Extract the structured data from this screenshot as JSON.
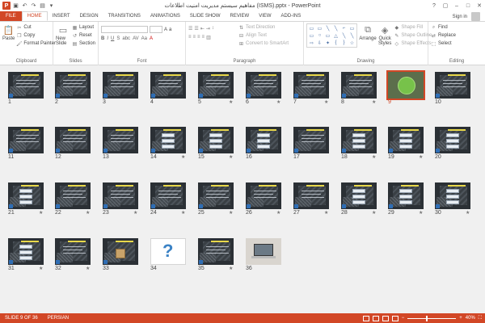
{
  "window": {
    "title": "مفاهیم سیستم مدیریت امنیت اطلاعات (ISMS).pptx - PowerPoint",
    "app_logo": "P",
    "controls": [
      "?",
      "▢",
      "–",
      "□",
      "✕"
    ]
  },
  "tabs": [
    "FILE",
    "HOME",
    "INSERT",
    "DESIGN",
    "TRANSITIONS",
    "ANIMATIONS",
    "SLIDE SHOW",
    "REVIEW",
    "VIEW",
    "ADD-INS"
  ],
  "active_tab": "HOME",
  "account": {
    "signin": "Sign in"
  },
  "ribbon": {
    "clipboard": {
      "label": "Clipboard",
      "paste": "Paste",
      "cut": "Cut",
      "copy": "Copy",
      "format_painter": "Format Painter"
    },
    "slides": {
      "label": "Slides",
      "new_slide": "New Slide",
      "layout": "Layout",
      "reset": "Reset",
      "section": "Section"
    },
    "font": {
      "label": "Font",
      "format_buttons": [
        "B",
        "I",
        "U",
        "S",
        "abc",
        "AV",
        "Aa",
        "A"
      ]
    },
    "paragraph": {
      "label": "Paragraph",
      "text_direction": "Text Direction",
      "align_text": "Align Text",
      "convert_smartart": "Convert to SmartArt"
    },
    "drawing": {
      "label": "Drawing",
      "arrange": "Arrange",
      "quick_styles": "Quick Styles",
      "shape_fill": "Shape Fill",
      "shape_outline": "Shape Outline",
      "shape_effects": "Shape Effects",
      "shapes": [
        "▭",
        "▭",
        "╲",
        "╲",
        "⌐",
        "▭",
        "▭",
        "○",
        "▭",
        "△",
        "╲",
        "╲",
        "⇨",
        "⇩",
        "✦",
        "{",
        "}",
        "☆"
      ]
    },
    "editing": {
      "label": "Editing",
      "find": "Find",
      "replace": "Replace",
      "select": "Select"
    }
  },
  "slides": [
    {
      "n": "1",
      "star": false,
      "style": "dark"
    },
    {
      "n": "2",
      "star": false,
      "style": "dark"
    },
    {
      "n": "3",
      "star": false,
      "style": "dark"
    },
    {
      "n": "4",
      "star": false,
      "style": "dark"
    },
    {
      "n": "5",
      "star": true,
      "style": "dark"
    },
    {
      "n": "6",
      "star": true,
      "style": "dark"
    },
    {
      "n": "7",
      "star": true,
      "style": "dark"
    },
    {
      "n": "8",
      "star": true,
      "style": "dark"
    },
    {
      "n": "9",
      "star": false,
      "style": "green",
      "selected": true
    },
    {
      "n": "10",
      "star": false,
      "style": "dark"
    },
    {
      "n": "11",
      "star": false,
      "style": "dark"
    },
    {
      "n": "12",
      "star": false,
      "style": "dark"
    },
    {
      "n": "13",
      "star": false,
      "style": "dark"
    },
    {
      "n": "14",
      "star": true,
      "style": "boxes"
    },
    {
      "n": "15",
      "star": true,
      "style": "boxes"
    },
    {
      "n": "16",
      "star": false,
      "style": "boxes"
    },
    {
      "n": "17",
      "star": false,
      "style": "dark"
    },
    {
      "n": "18",
      "star": true,
      "style": "boxes"
    },
    {
      "n": "19",
      "star": true,
      "style": "boxes"
    },
    {
      "n": "20",
      "star": false,
      "style": "boxes"
    },
    {
      "n": "21",
      "star": true,
      "style": "boxes"
    },
    {
      "n": "22",
      "star": true,
      "style": "dark"
    },
    {
      "n": "23",
      "star": true,
      "style": "dark"
    },
    {
      "n": "24",
      "star": true,
      "style": "dark"
    },
    {
      "n": "25",
      "star": true,
      "style": "dark"
    },
    {
      "n": "26",
      "star": true,
      "style": "dark"
    },
    {
      "n": "27",
      "star": true,
      "style": "dark"
    },
    {
      "n": "28",
      "star": true,
      "style": "boxes"
    },
    {
      "n": "29",
      "star": true,
      "style": "boxes"
    },
    {
      "n": "30",
      "star": true,
      "style": "boxes"
    },
    {
      "n": "31",
      "star": true,
      "style": "boxes"
    },
    {
      "n": "32",
      "star": true,
      "style": "dark"
    },
    {
      "n": "33",
      "star": false,
      "style": "frame"
    },
    {
      "n": "34",
      "star": false,
      "style": "question"
    },
    {
      "n": "35",
      "star": true,
      "style": "dark"
    },
    {
      "n": "36",
      "star": false,
      "style": "laptop"
    }
  ],
  "status": {
    "slide_indicator": "SLIDE 9 OF 36",
    "language": "PERSIAN",
    "zoom_minus": "−",
    "zoom_plus": "+",
    "zoom_level": "40%",
    "zoom_fraction": 0.4
  }
}
